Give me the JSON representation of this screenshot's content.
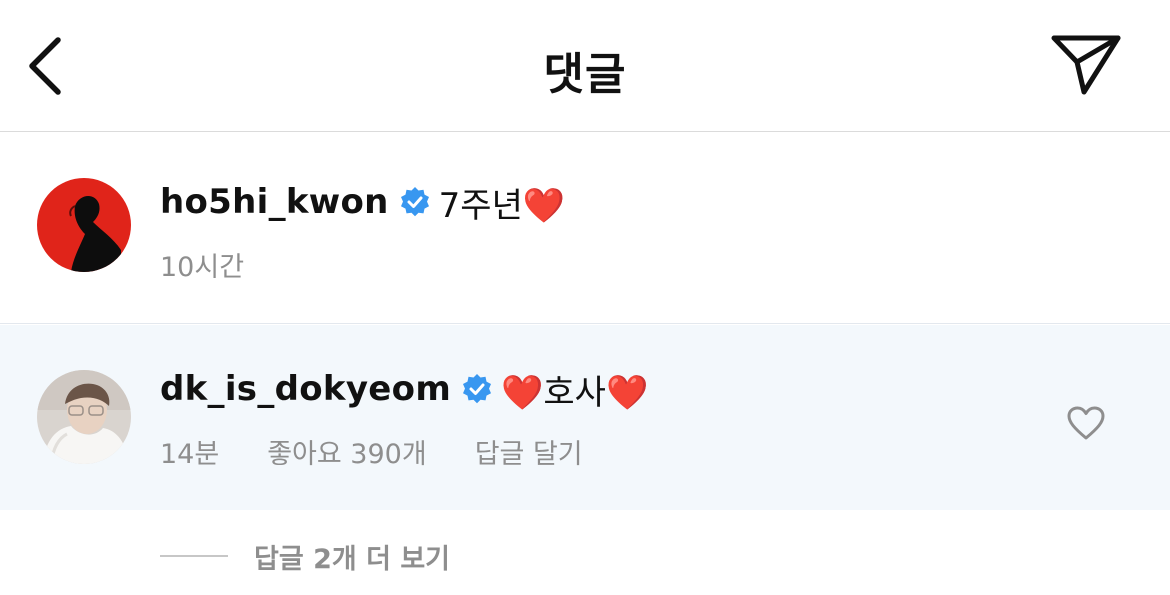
{
  "header": {
    "title": "댓글",
    "back_icon": "chevron-left-icon",
    "share_icon": "paper-plane-icon"
  },
  "comments": [
    {
      "username": "ho5hi_kwon",
      "verified": true,
      "text": "7주년❤️",
      "time": "10시간",
      "avatar_colors": [
        "#e0241a",
        "#0d0d0d"
      ]
    },
    {
      "username": "dk_is_dokyeom",
      "verified": true,
      "text": "❤️호사❤️",
      "time": "14분",
      "likes": "좋아요 390개",
      "reply_label": "답글 달기",
      "highlighted": true,
      "highlight_color": "#f3f8fc"
    }
  ],
  "view_replies": {
    "label": "답글 2개 더 보기"
  },
  "colors": {
    "verified_badge": "#3897f0",
    "muted_text": "#8e8e8e",
    "divider": "#dbdbdb"
  }
}
